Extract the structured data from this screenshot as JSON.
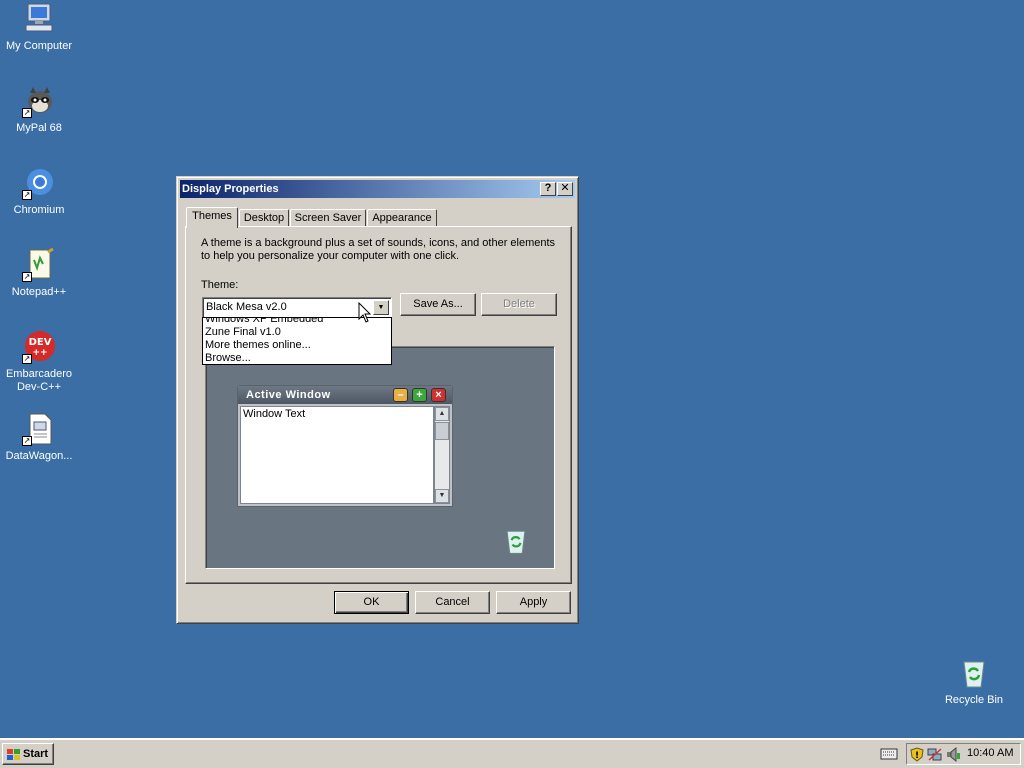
{
  "desktop": {
    "icons": [
      {
        "label": "My Computer"
      },
      {
        "label": "MyPal 68"
      },
      {
        "label": "Chromium"
      },
      {
        "label": "Notepad++"
      },
      {
        "label_line1": "Embarcadero",
        "label_line2": "Dev-C++"
      },
      {
        "label": "DataWagon..."
      },
      {
        "label": "Recycle Bin"
      }
    ],
    "background_color": "#3a6ea5"
  },
  "dialog": {
    "title": "Display Properties",
    "help_button": "?",
    "close_button": "✕",
    "tabs": [
      {
        "label": "Themes",
        "active": true
      },
      {
        "label": "Desktop"
      },
      {
        "label": "Screen Saver"
      },
      {
        "label": "Appearance"
      }
    ],
    "description": "A theme is a background plus a set of sounds, icons, and other elements to help you personalize your computer with one click.",
    "theme_label": "Theme:",
    "theme_selected": "Black Mesa v2.0",
    "dropdown_items": [
      "Windows XP Embedded",
      "Zune Final v1.0",
      "More themes online...",
      "Browse..."
    ],
    "save_as_button": "Save As...",
    "delete_button": "Delete",
    "preview": {
      "window_title": "Active Window",
      "window_text": "Window Text"
    },
    "ok_button": "OK",
    "cancel_button": "Cancel",
    "apply_button": "Apply"
  },
  "taskbar": {
    "start_label": "Start",
    "clock": "10:40 AM"
  }
}
